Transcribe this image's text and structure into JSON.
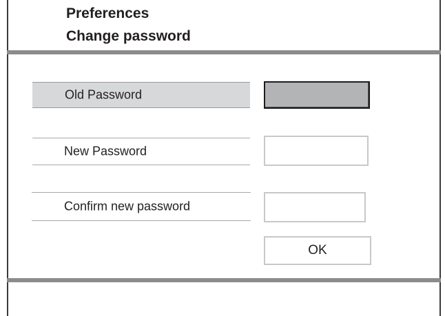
{
  "header": {
    "title": "Preferences",
    "subtitle": "Change password"
  },
  "form": {
    "old_password": {
      "label": "Old Password",
      "value": ""
    },
    "new_password": {
      "label": "New Password",
      "value": ""
    },
    "confirm_password": {
      "label": "Confirm new password",
      "value": ""
    }
  },
  "actions": {
    "ok_label": "OK"
  },
  "colors": {
    "highlight": "#d7d8da",
    "focused_input": "#b3b4b6",
    "divider": "#8c8c8c",
    "border": "#c8c8c8"
  }
}
